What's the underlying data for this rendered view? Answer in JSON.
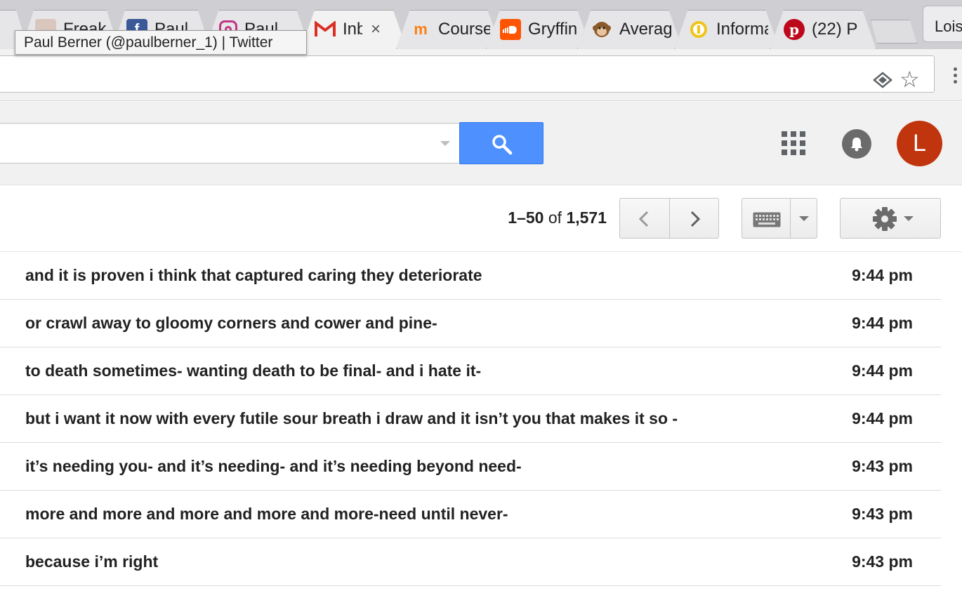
{
  "browser": {
    "tabs": [
      {
        "title": "",
        "icon": "partial-tab-icon"
      },
      {
        "title": "Freak",
        "icon": "photo-favicon"
      },
      {
        "title": "Paul",
        "icon": "facebook-icon",
        "color": "#3b5998"
      },
      {
        "title": "Paul",
        "icon": "instagram-icon",
        "color": "#c13584"
      },
      {
        "title": "Inbox",
        "icon": "gmail-icon",
        "color": "#d93025",
        "close": "×"
      },
      {
        "title": "Course",
        "icon": "moodle-icon",
        "color": "#f98012"
      },
      {
        "title": "Gryffin",
        "icon": "soundcloud-icon",
        "color": "#ff5500"
      },
      {
        "title": "Average",
        "icon": "monkey-icon",
        "color": "#a0522d"
      },
      {
        "title": "Information",
        "icon": "yellow-badge-icon",
        "color": "#f0c419"
      },
      {
        "title": "(22) P",
        "icon": "pinterest-icon",
        "color": "#bd081c"
      }
    ],
    "profile_name": "Lois",
    "tooltip": "Paul Berner (@paulberner_1) | Twitter"
  },
  "gmail": {
    "account_initial": "L",
    "avatar_color": "#c1350e",
    "search_button_color": "#4d90fe",
    "pagination": {
      "range": "1–50",
      "of": "of",
      "total": "1,571"
    },
    "messages": [
      {
        "subject": "and it is proven i think that captured caring they deteriorate",
        "time": "9:44 pm"
      },
      {
        "subject": "or crawl away to gloomy corners and cower and pine-",
        "time": "9:44 pm"
      },
      {
        "subject": "to death sometimes- wanting death to be final- and i hate it-",
        "time": "9:44 pm"
      },
      {
        "subject": "but i want it now with every futile sour breath i draw and it isn’t you that makes it so -",
        "time": "9:44 pm"
      },
      {
        "subject": "it’s needing you- and it’s needing- and it’s needing beyond need-",
        "time": "9:43 pm"
      },
      {
        "subject": "more and more and more and more and more-need until never-",
        "time": "9:43 pm"
      },
      {
        "subject": "because i’m right",
        "time": "9:43 pm"
      }
    ]
  }
}
